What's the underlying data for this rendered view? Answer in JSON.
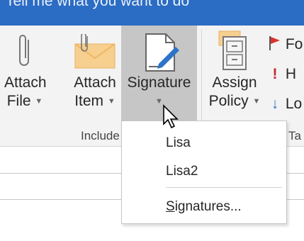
{
  "tellme": {
    "text": "Tell me what you want to do"
  },
  "ribbon": {
    "attach_file": {
      "line1": "Attach",
      "line2": "File"
    },
    "attach_item": {
      "line1": "Attach",
      "line2": "Item"
    },
    "signature": {
      "line1": "Signature"
    },
    "assign_policy": {
      "line1": "Assign",
      "line2": "Policy"
    },
    "group_include": "Include",
    "tags_group": "Ta",
    "mini": [
      "Fo",
      "H",
      "Lo"
    ]
  },
  "signature_menu": {
    "items": [
      "Lisa",
      "Lisa2"
    ],
    "manage": "Signatures..."
  },
  "colors": {
    "accent": "#2b6cc4",
    "flag": "#d9342b",
    "importance": "#c4262e",
    "arrow": "#2d73c7"
  }
}
